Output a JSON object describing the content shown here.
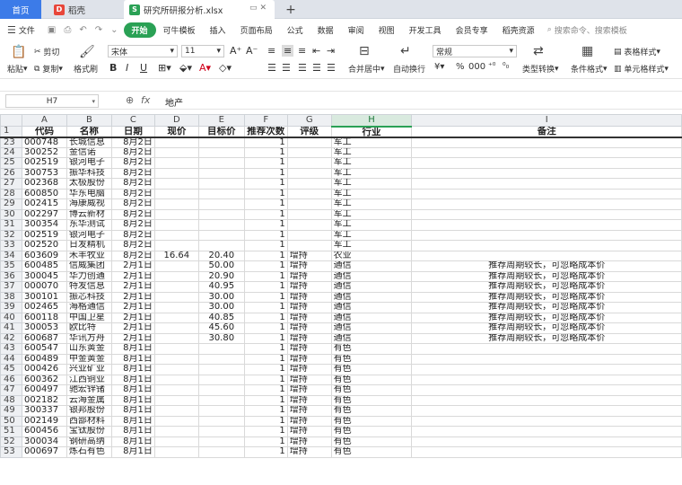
{
  "tabs": {
    "home": "首页",
    "docer": "稻壳",
    "file": "研究所研报分析.xlsx",
    "add": "+"
  },
  "menu": {
    "file": "文件",
    "start": "开始",
    "items": [
      "可牛模板",
      "插入",
      "页面布局",
      "公式",
      "数据",
      "审阅",
      "视图",
      "开发工具",
      "会员专享",
      "稻壳资源"
    ],
    "search": "搜索命令、搜索模板"
  },
  "ribbon": {
    "paste": "粘贴",
    "cut": "剪切",
    "copy": "复制",
    "format_painter": "格式刷",
    "font_name": "宋体",
    "font_size": "11",
    "merge": "合并居中",
    "wrap": "自动换行",
    "number_format": "常规",
    "type_convert": "类型转换",
    "cond_format": "条件格式",
    "table_style": "表格样式",
    "cell_style": "单元格样式"
  },
  "formula_bar": {
    "name_box": "H7",
    "value": "地产"
  },
  "columns": [
    "A",
    "B",
    "C",
    "D",
    "E",
    "F",
    "G",
    "H",
    "I"
  ],
  "header_row": {
    "row_num": "1",
    "cells": [
      "代码",
      "名称",
      "日期",
      "现价",
      "目标价",
      "推荐次数",
      "评级",
      "行业",
      "备注"
    ]
  },
  "rows": [
    {
      "n": "23",
      "a": "000748",
      "b": "长城信息",
      "c": "8月2日",
      "d": "",
      "e": "",
      "f": "1",
      "g": "",
      "h": "军工",
      "i": ""
    },
    {
      "n": "24",
      "a": "300252",
      "b": "金信诺",
      "c": "8月2日",
      "d": "",
      "e": "",
      "f": "1",
      "g": "",
      "h": "军工",
      "i": ""
    },
    {
      "n": "25",
      "a": "002519",
      "b": "银河电子",
      "c": "8月2日",
      "d": "",
      "e": "",
      "f": "1",
      "g": "",
      "h": "军工",
      "i": ""
    },
    {
      "n": "26",
      "a": "300753",
      "b": "振华科技",
      "c": "8月2日",
      "d": "",
      "e": "",
      "f": "1",
      "g": "",
      "h": "军工",
      "i": ""
    },
    {
      "n": "27",
      "a": "002368",
      "b": "太极股份",
      "c": "8月2日",
      "d": "",
      "e": "",
      "f": "1",
      "g": "",
      "h": "军工",
      "i": ""
    },
    {
      "n": "28",
      "a": "600850",
      "b": "华东电脑",
      "c": "8月2日",
      "d": "",
      "e": "",
      "f": "1",
      "g": "",
      "h": "军工",
      "i": ""
    },
    {
      "n": "29",
      "a": "002415",
      "b": "海康威视",
      "c": "8月2日",
      "d": "",
      "e": "",
      "f": "1",
      "g": "",
      "h": "军工",
      "i": ""
    },
    {
      "n": "30",
      "a": "002297",
      "b": "博云新材",
      "c": "8月2日",
      "d": "",
      "e": "",
      "f": "1",
      "g": "",
      "h": "军工",
      "i": ""
    },
    {
      "n": "31",
      "a": "300354",
      "b": "东华测试",
      "c": "8月2日",
      "d": "",
      "e": "",
      "f": "1",
      "g": "",
      "h": "军工",
      "i": ""
    },
    {
      "n": "32",
      "a": "002519",
      "b": "银河电子",
      "c": "8月2日",
      "d": "",
      "e": "",
      "f": "1",
      "g": "",
      "h": "军工",
      "i": ""
    },
    {
      "n": "33",
      "a": "002520",
      "b": "日发精机",
      "c": "8月2日",
      "d": "",
      "e": "",
      "f": "1",
      "g": "",
      "h": "军工",
      "i": ""
    },
    {
      "n": "34",
      "a": "603609",
      "b": "禾丰牧业",
      "c": "8月2日",
      "d": "16.64",
      "e": "20.40",
      "f": "1",
      "g": "增持",
      "h": "农业",
      "i": ""
    },
    {
      "n": "35",
      "a": "600485",
      "b": "信威集团",
      "c": "2月1日",
      "d": "",
      "e": "50.00",
      "f": "1",
      "g": "增持",
      "h": "通信",
      "i": "推荐周期较长，可忽略成本价"
    },
    {
      "n": "36",
      "a": "300045",
      "b": "华力创通",
      "c": "2月1日",
      "d": "",
      "e": "20.90",
      "f": "1",
      "g": "增持",
      "h": "通信",
      "i": "推荐周期较长，可忽略成本价"
    },
    {
      "n": "37",
      "a": "000070",
      "b": "特发信息",
      "c": "2月1日",
      "d": "",
      "e": "40.95",
      "f": "1",
      "g": "增持",
      "h": "通信",
      "i": "推荐周期较长，可忽略成本价"
    },
    {
      "n": "38",
      "a": "300101",
      "b": "振芯科技",
      "c": "2月1日",
      "d": "",
      "e": "30.00",
      "f": "1",
      "g": "增持",
      "h": "通信",
      "i": "推荐周期较长，可忽略成本价"
    },
    {
      "n": "39",
      "a": "002465",
      "b": "海格通信",
      "c": "2月1日",
      "d": "",
      "e": "30.00",
      "f": "1",
      "g": "增持",
      "h": "通信",
      "i": "推荐周期较长，可忽略成本价"
    },
    {
      "n": "40",
      "a": "600118",
      "b": "中国卫星",
      "c": "2月1日",
      "d": "",
      "e": "40.85",
      "f": "1",
      "g": "增持",
      "h": "通信",
      "i": "推荐周期较长，可忽略成本价"
    },
    {
      "n": "41",
      "a": "300053",
      "b": "欧比特",
      "c": "2月1日",
      "d": "",
      "e": "45.60",
      "f": "1",
      "g": "增持",
      "h": "通信",
      "i": "推荐周期较长，可忽略成本价"
    },
    {
      "n": "42",
      "a": "600687",
      "b": "华讯方舟",
      "c": "2月1日",
      "d": "",
      "e": "30.80",
      "f": "1",
      "g": "增持",
      "h": "通信",
      "i": "推荐周期较长，可忽略成本价"
    },
    {
      "n": "43",
      "a": "600547",
      "b": "山东黄金",
      "c": "8月1日",
      "d": "",
      "e": "",
      "f": "1",
      "g": "增持",
      "h": "有色",
      "i": ""
    },
    {
      "n": "44",
      "a": "600489",
      "b": "中金黄金",
      "c": "8月1日",
      "d": "",
      "e": "",
      "f": "1",
      "g": "增持",
      "h": "有色",
      "i": ""
    },
    {
      "n": "45",
      "a": "000426",
      "b": "兴业矿业",
      "c": "8月1日",
      "d": "",
      "e": "",
      "f": "1",
      "g": "增持",
      "h": "有色",
      "i": ""
    },
    {
      "n": "46",
      "a": "600362",
      "b": "江西铜业",
      "c": "8月1日",
      "d": "",
      "e": "",
      "f": "1",
      "g": "增持",
      "h": "有色",
      "i": ""
    },
    {
      "n": "47",
      "a": "600497",
      "b": "驰宏锌锗",
      "c": "8月1日",
      "d": "",
      "e": "",
      "f": "1",
      "g": "增持",
      "h": "有色",
      "i": ""
    },
    {
      "n": "48",
      "a": "002182",
      "b": "云海金属",
      "c": "8月1日",
      "d": "",
      "e": "",
      "f": "1",
      "g": "增持",
      "h": "有色",
      "i": ""
    },
    {
      "n": "49",
      "a": "300337",
      "b": "银邦股份",
      "c": "8月1日",
      "d": "",
      "e": "",
      "f": "1",
      "g": "增持",
      "h": "有色",
      "i": ""
    },
    {
      "n": "50",
      "a": "002149",
      "b": "西部材料",
      "c": "8月1日",
      "d": "",
      "e": "",
      "f": "1",
      "g": "增持",
      "h": "有色",
      "i": ""
    },
    {
      "n": "51",
      "a": "600456",
      "b": "宝钛股份",
      "c": "8月1日",
      "d": "",
      "e": "",
      "f": "1",
      "g": "增持",
      "h": "有色",
      "i": ""
    },
    {
      "n": "52",
      "a": "300034",
      "b": "钢研高纳",
      "c": "8月1日",
      "d": "",
      "e": "",
      "f": "1",
      "g": "增持",
      "h": "有色",
      "i": ""
    },
    {
      "n": "53",
      "a": "000697",
      "b": "炼石有色",
      "c": "8月1日",
      "d": "",
      "e": "",
      "f": "1",
      "g": "增持",
      "h": "有色",
      "i": ""
    }
  ]
}
